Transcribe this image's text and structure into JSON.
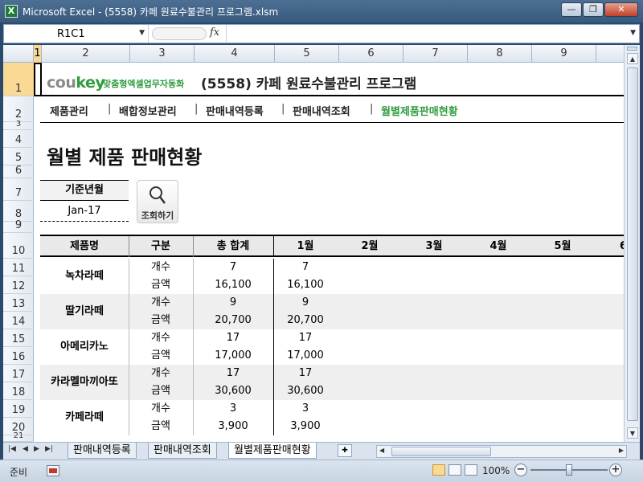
{
  "window": {
    "title": "Microsoft Excel - (5558) 카페 원료수불관리 프로그램.xlsm",
    "app_icon": "X",
    "buttons": {
      "minimize": "—",
      "restore": "❐",
      "close": "✕"
    }
  },
  "formula_bar": {
    "name_box": "R1C1",
    "fx_label": "fx",
    "formula": ""
  },
  "columns": [
    "1",
    "2",
    "3",
    "4",
    "5",
    "6",
    "7",
    "8",
    "9"
  ],
  "rows": [
    "1",
    "2",
    "3",
    "4",
    "5",
    "6",
    "7",
    "8",
    "9",
    "10",
    "11",
    "12",
    "13",
    "14",
    "15",
    "16",
    "17",
    "18",
    "19",
    "20",
    "21"
  ],
  "header": {
    "logo_main": "cou",
    "logo_accent": "key",
    "logo_sub": "맞춤형엑셀업무자동화",
    "title": "(5558) 카페 원료수불관리 프로그램"
  },
  "nav": {
    "items": [
      "제품관리",
      "배합정보관리",
      "판매내역등록",
      "판매내역조회",
      "월별제품판매현황"
    ],
    "separator": "|",
    "active_index": 4
  },
  "page": {
    "title": "월별 제품 판매현황",
    "period_label": "기준년월",
    "period_value": "Jan-17",
    "search_button": "조회하기"
  },
  "table": {
    "headers": [
      "제품명",
      "구분",
      "총 합계",
      "1월",
      "2월",
      "3월",
      "4월",
      "5월",
      "6"
    ],
    "sub_labels": [
      "개수",
      "금액"
    ],
    "rows": [
      {
        "name": "녹차라떼",
        "count_total": "7",
        "count_jan": "7",
        "amount_total": "16,100",
        "amount_jan": "16,100"
      },
      {
        "name": "딸기라떼",
        "count_total": "9",
        "count_jan": "9",
        "amount_total": "20,700",
        "amount_jan": "20,700"
      },
      {
        "name": "아메리카노",
        "count_total": "17",
        "count_jan": "17",
        "amount_total": "17,000",
        "amount_jan": "17,000"
      },
      {
        "name": "카라멜마끼아또",
        "count_total": "17",
        "count_jan": "17",
        "amount_total": "30,600",
        "amount_jan": "30,600"
      },
      {
        "name": "카페라떼",
        "count_total": "3",
        "count_jan": "3",
        "amount_total": "3,900",
        "amount_jan": "3,900"
      }
    ]
  },
  "sheet_tabs": {
    "tabs": [
      "판매내역등록",
      "판매내역조회",
      "월별제품판매현황"
    ],
    "active_index": 2
  },
  "status_bar": {
    "mode": "준비",
    "zoom": "100%",
    "zoom_minus": "−",
    "zoom_plus": "+"
  },
  "colors": {
    "accent_green": "#2e9d3e",
    "selected_header": "#f9d993",
    "title_bar": "#4d6f93"
  }
}
